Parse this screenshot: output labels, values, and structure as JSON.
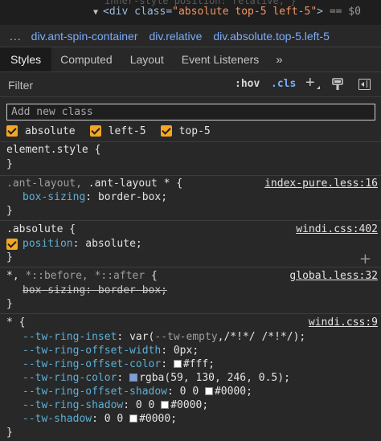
{
  "dom": {
    "ghost_line": "inner-style position: relative; }",
    "tag_open": "<div",
    "attr_name": "class",
    "attr_value": "\"absolute top-5 left-5\"",
    "tag_close": ">",
    "eq_dollar": "== $0"
  },
  "breadcrumbs": {
    "more": "...",
    "items": [
      "div.ant-spin-container",
      "div.relative",
      "div.absolute.top-5.left-5"
    ]
  },
  "tabs": [
    "Styles",
    "Computed",
    "Layout",
    "Event Listeners",
    "»"
  ],
  "filter": {
    "placeholder": "Filter",
    "hov": ":hov",
    "cls": ".cls"
  },
  "class_input_placeholder": "Add new class",
  "classes": [
    "absolute",
    "left-5",
    "top-5"
  ],
  "rules": {
    "element_style": {
      "selector": "element.style {",
      "close": "}"
    },
    "ant_layout": {
      "selector_dim": ".ant-layout, ",
      "selector": ".ant-layout * {",
      "source": "index-pure.less:16",
      "prop": "box-sizing",
      "value": "border-box;",
      "close": "}"
    },
    "absolute": {
      "selector": ".absolute {",
      "source": "windi.css:402",
      "prop": "position",
      "value": "absolute;",
      "close": "}"
    },
    "universal_pseudo": {
      "selector": "*, ",
      "selector_dim": "*::before, *::after",
      "selector_end": " {",
      "source": "global.less:32",
      "struck": "box-sizing: border-box;",
      "close": "}"
    },
    "universal": {
      "selector": "* {",
      "source": "windi.css:9",
      "close": "}",
      "decls": [
        {
          "prop": "--tw-ring-inset",
          "pre": "var(",
          "dim": "--tw-empty",
          "post": ",/*!*/ /*!*/);"
        },
        {
          "prop": "--tw-ring-offset-width",
          "value": "0px;"
        },
        {
          "prop": "--tw-ring-offset-color",
          "swatch": "#ffffff",
          "value": "#fff;"
        },
        {
          "prop": "--tw-ring-color",
          "swatch": "#3b82f6",
          "value": "rgba(59, 130, 246, 0.5);"
        },
        {
          "prop": "--tw-ring-offset-shadow",
          "pre": "0 0 ",
          "swatch": "#ffffff",
          "value": "#0000;"
        },
        {
          "prop": "--tw-ring-shadow",
          "pre": "0 0 ",
          "swatch": "#ffffff",
          "value": "#0000;"
        },
        {
          "prop": "--tw-shadow",
          "pre": "0 0 ",
          "swatch": "#ffffff",
          "value": "#0000;"
        }
      ]
    }
  }
}
